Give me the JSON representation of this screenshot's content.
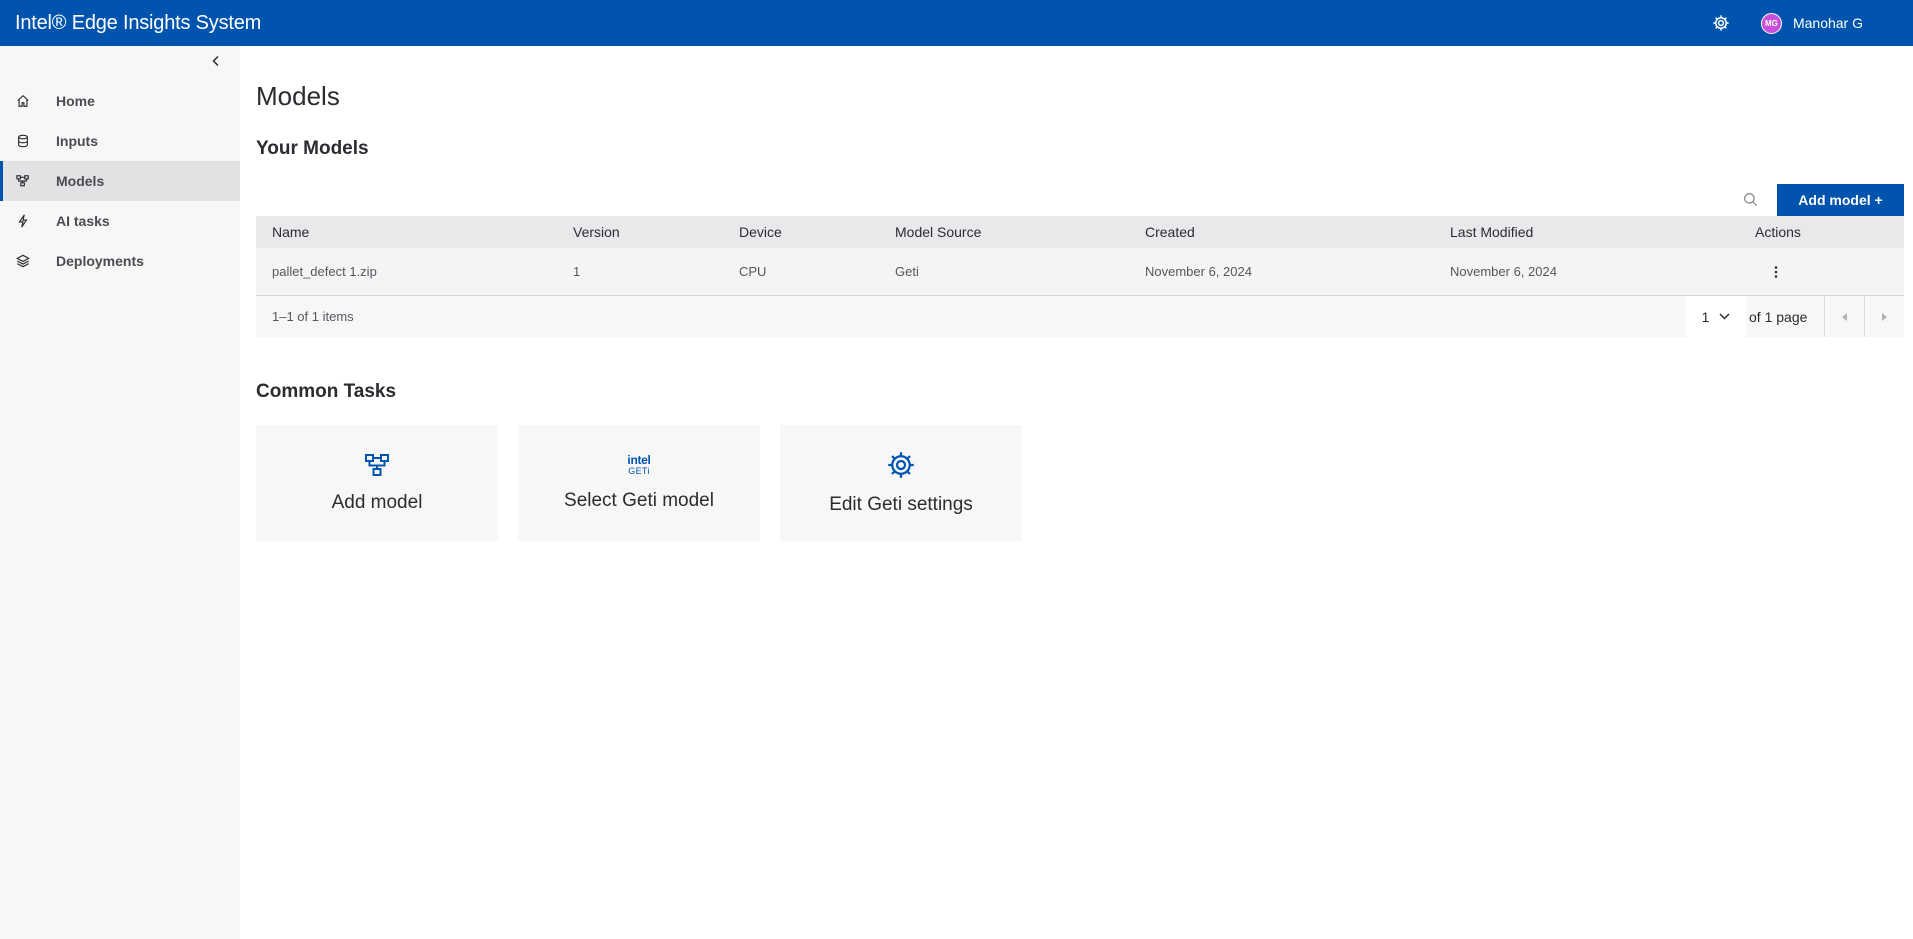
{
  "app": {
    "brand": "Intel® Edge Insights System",
    "user_initials": "MG",
    "user_name": "Manohar G"
  },
  "sidebar": {
    "items": [
      {
        "label": "Home",
        "icon": "home-icon"
      },
      {
        "label": "Inputs",
        "icon": "database-icon"
      },
      {
        "label": "Models",
        "icon": "model-network-icon",
        "active": true
      },
      {
        "label": "AI tasks",
        "icon": "lightning-icon"
      },
      {
        "label": "Deployments",
        "icon": "layers-icon"
      }
    ]
  },
  "page": {
    "title": "Models",
    "your_models_title": "Your Models",
    "add_model_label": "Add model +",
    "common_tasks_title": "Common Tasks"
  },
  "table": {
    "columns": [
      "Name",
      "Version",
      "Device",
      "Model Source",
      "Created",
      "Last Modified",
      "Actions"
    ],
    "rows": [
      {
        "name": "pallet_defect 1.zip",
        "version": "1",
        "device": "CPU",
        "source": "Geti",
        "created": "November 6, 2024",
        "modified": "November 6, 2024"
      }
    ],
    "footer": {
      "items_text": "1–1 of 1 items",
      "page": "1",
      "of_pages": "of 1 page"
    }
  },
  "tasks": [
    {
      "label": "Add model",
      "icon": "model-network-icon"
    },
    {
      "label": "Select Geti model",
      "icon": "intel-geti-logo",
      "logo_line1": "intel",
      "logo_line2": "GETi"
    },
    {
      "label": "Edit Geti settings",
      "icon": "gear-icon"
    }
  ],
  "colors": {
    "brand_blue": "#0054ae",
    "avatar": "#c84fd8"
  }
}
